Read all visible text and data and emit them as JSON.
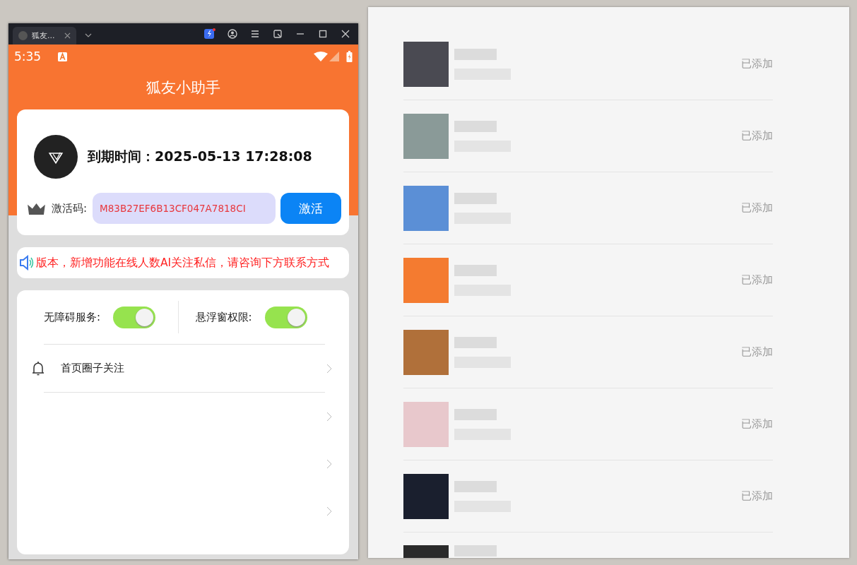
{
  "emulator": {
    "tab_title": "狐友..."
  },
  "status_bar": {
    "time": "5:35"
  },
  "app": {
    "title": "狐友小助手",
    "expiry": "到期时间：2025-05-13 17:28:08",
    "activation": {
      "label": "激活码:",
      "value": "M83B27EF6B13CF047A7818CI",
      "button": "激活"
    },
    "notice": "版本，新增功能在线人数AI关注私信，请咨询下方联系方式",
    "toggles": [
      {
        "label": "无障碍服务:",
        "on": true
      },
      {
        "label": "悬浮窗权限:",
        "on": true
      }
    ],
    "menu_items": [
      {
        "kind": "bell",
        "label": "首页圈子关注"
      },
      {
        "kind": "blank"
      },
      {
        "kind": "blank"
      },
      {
        "kind": "blank"
      }
    ]
  },
  "contacts": [
    {
      "kind": "full",
      "status": "已添加"
    },
    {
      "kind": "full",
      "status": "已添加"
    },
    {
      "kind": "full",
      "status": "已添加"
    },
    {
      "kind": "full",
      "status": "已添加"
    },
    {
      "kind": "full",
      "status": "已添加"
    },
    {
      "kind": "full",
      "status": "已添加"
    },
    {
      "kind": "full",
      "status": "已添加"
    },
    {
      "kind": "cut"
    }
  ]
}
